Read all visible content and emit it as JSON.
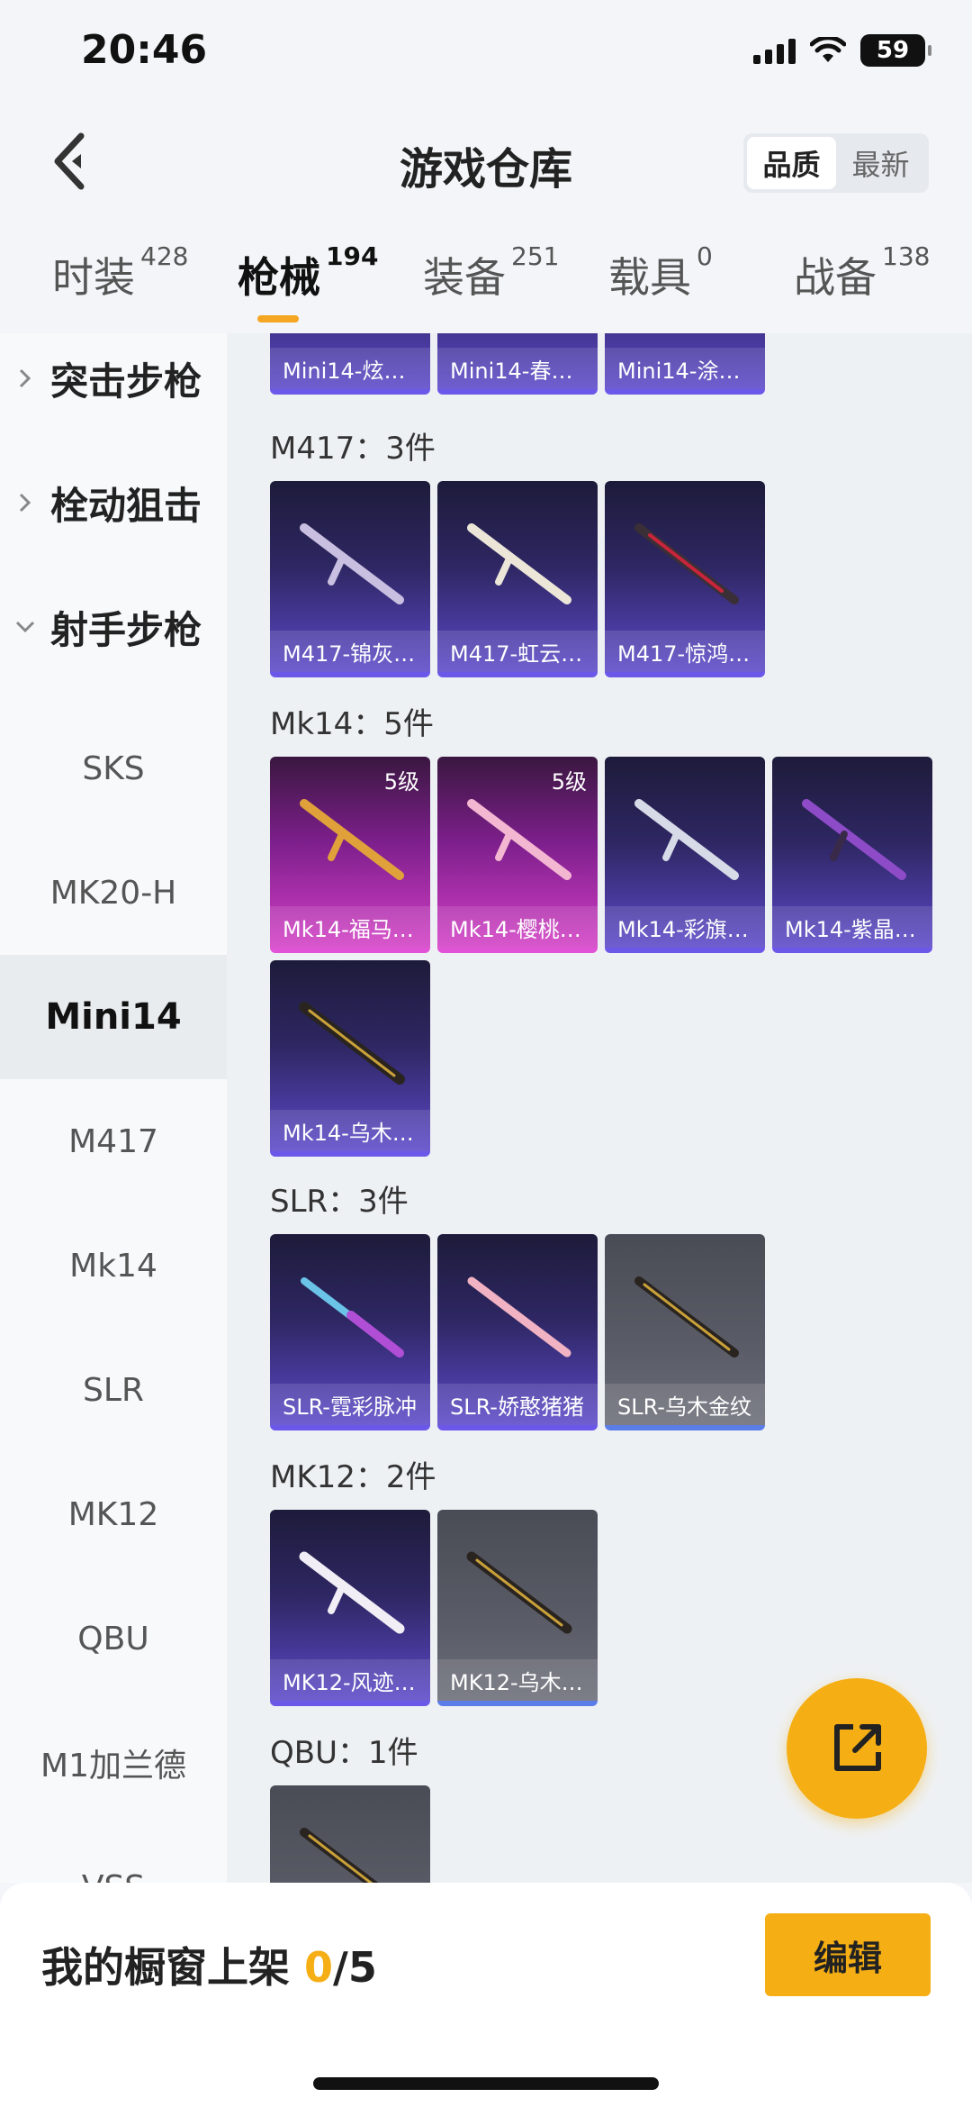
{
  "status": {
    "time": "20:46",
    "battery": "59"
  },
  "header": {
    "title": "游戏仓库",
    "sort_quality": "品质",
    "sort_newest": "最新"
  },
  "tabs": [
    {
      "label": "时装",
      "count": "428"
    },
    {
      "label": "枪械",
      "count": "194"
    },
    {
      "label": "装备",
      "count": "251"
    },
    {
      "label": "载具",
      "count": "0"
    },
    {
      "label": "战备",
      "count": "138"
    }
  ],
  "sidebar": {
    "groups": [
      "突击步枪",
      "栓动狙击",
      "射手步枪"
    ],
    "items": [
      "SKS",
      "MK20-H",
      "Mini14",
      "M417",
      "Mk14",
      "SLR",
      "MK12",
      "QBU",
      "M1加兰德",
      "VSS"
    ]
  },
  "content": {
    "mini14_cards": [
      "Mini14-炫…",
      "Mini14-春…",
      "Mini14-涂…"
    ],
    "sections": [
      {
        "title": "M417：3件",
        "cards": [
          "M417-锦灰…",
          "M417-虹云…",
          "M417-惊鸿…"
        ]
      },
      {
        "title": "Mk14：5件",
        "cards": [
          "Mk14-福马…",
          "Mk14-樱桃…",
          "Mk14-彩旗…",
          "Mk14-紫晶…",
          "Mk14-乌木…"
        ],
        "level": "5级"
      },
      {
        "title": "SLR：3件",
        "cards": [
          "SLR-霓彩脉冲",
          "SLR-娇憨猪猪",
          "SLR-乌木金纹"
        ]
      },
      {
        "title": "MK12：2件",
        "cards": [
          "MK12-风迹…",
          "MK12-乌木…"
        ]
      },
      {
        "title": "QBU：1件",
        "cards": []
      }
    ]
  },
  "bottom": {
    "showcase_label": "我的橱窗上架",
    "showcase_current": "0",
    "showcase_total": "/5",
    "edit_label": "编辑"
  }
}
